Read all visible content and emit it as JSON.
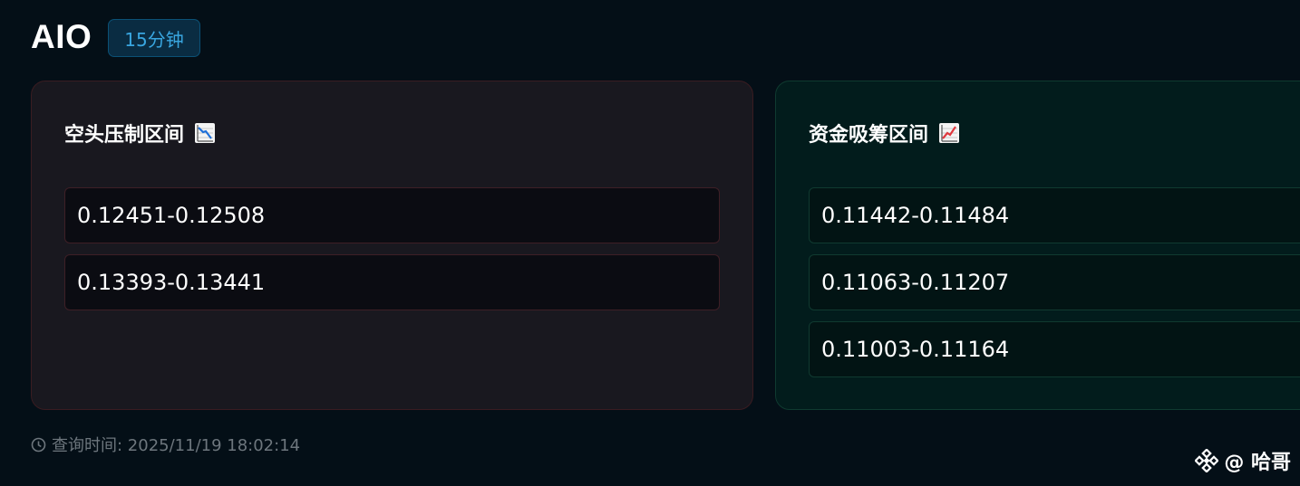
{
  "header": {
    "title": "AIO",
    "timeframe_badge": "15分钟"
  },
  "short_zone": {
    "title": "空头压制区间",
    "icon": "chart-decreasing-icon",
    "accent_color": "#3e1f26",
    "ranges": [
      "0.12451-0.12508",
      "0.13393-0.13441"
    ]
  },
  "long_zone": {
    "title": "资金吸筹区间",
    "icon": "chart-increasing-icon",
    "accent_color": "#103a30",
    "ranges": [
      "0.11442-0.11484",
      "0.11063-0.11207",
      "0.11003-0.11164"
    ]
  },
  "footer": {
    "query_time": "查询时间: 2025/11/19 18:02:14"
  },
  "watermark": {
    "text": "@ 哈哥",
    "icon": "binance-logo-icon"
  }
}
